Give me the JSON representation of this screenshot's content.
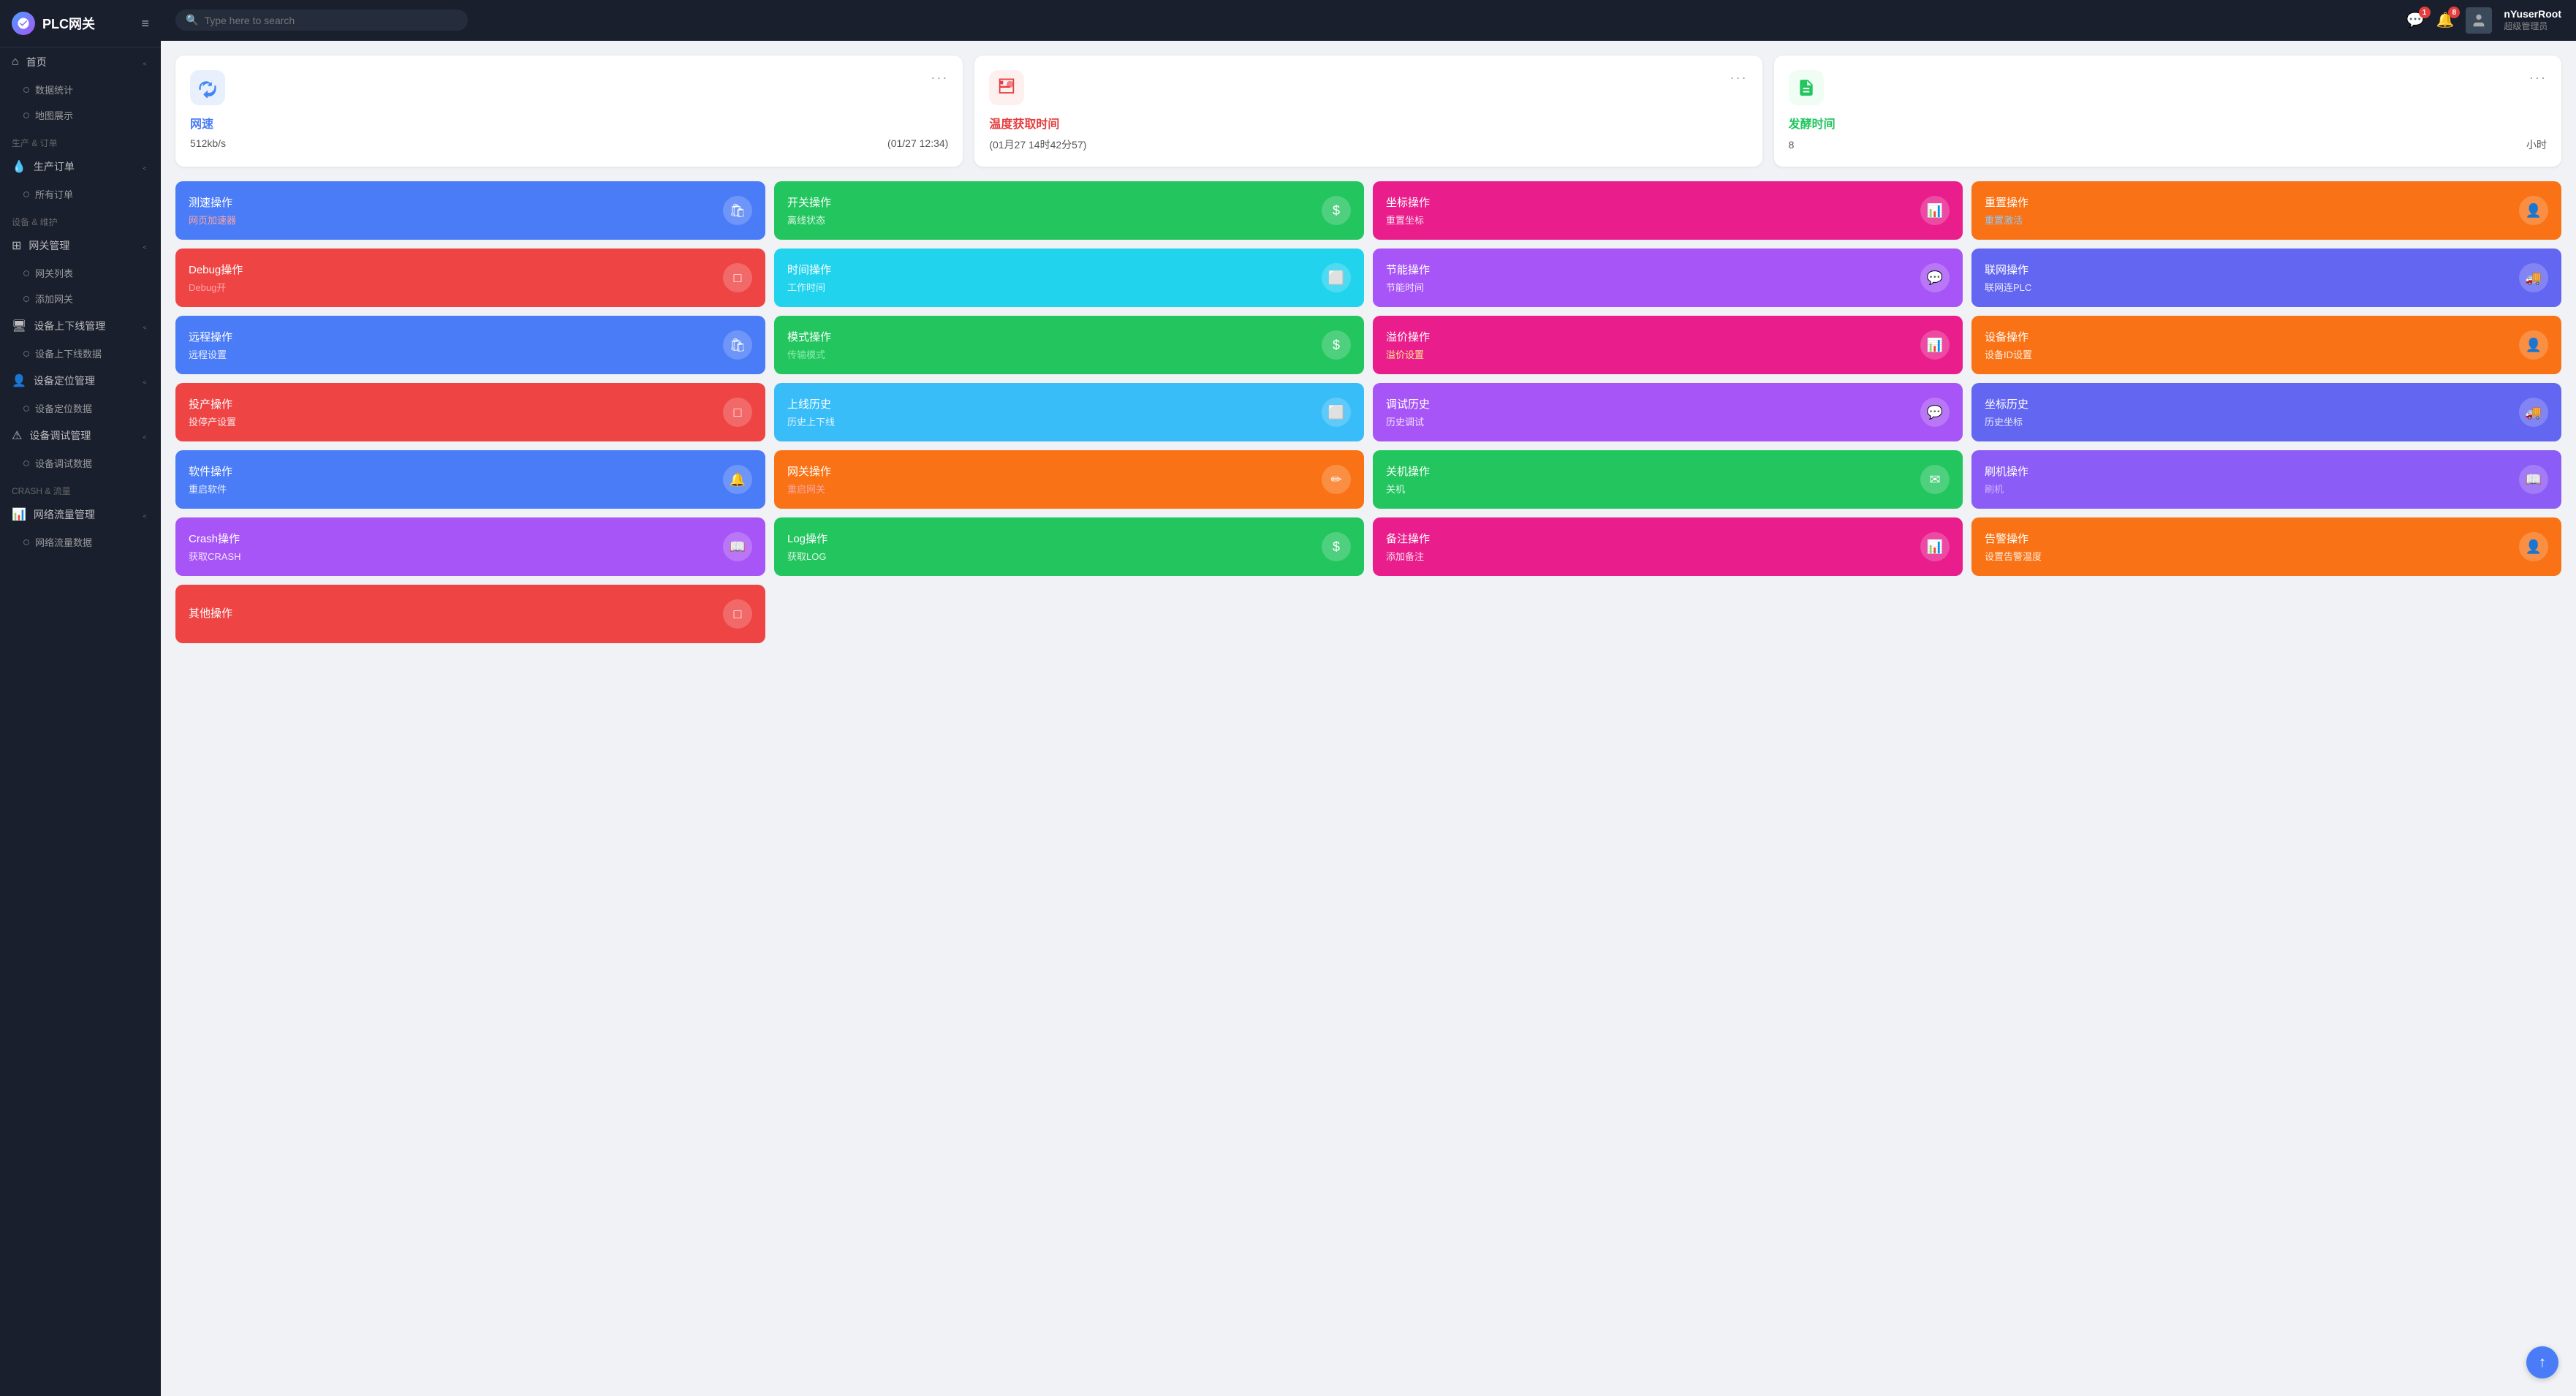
{
  "app": {
    "logo_icon": "⚙",
    "logo_text": "PLC网关",
    "hamburger": "≡"
  },
  "search": {
    "placeholder": "Type here to search"
  },
  "topbar": {
    "notif1_count": "1",
    "notif2_count": "8",
    "user_name": "nYuserRoot",
    "user_role": "超级管理员"
  },
  "sidebar": {
    "sections": [
      {
        "label": "",
        "items": [
          {
            "icon": "⌂",
            "label": "首页",
            "has_chevron": true,
            "sub": []
          },
          {
            "icon": "◉",
            "label": "数据统计",
            "has_chevron": false,
            "sub": []
          },
          {
            "icon": "◉",
            "label": "地图展示",
            "has_chevron": false,
            "sub": []
          }
        ]
      },
      {
        "label": "生产 & 订单",
        "items": [
          {
            "icon": "💧",
            "label": "生产订单",
            "has_chevron": true,
            "sub": []
          },
          {
            "icon": "◉",
            "label": "所有订单",
            "has_chevron": false,
            "sub": []
          }
        ]
      },
      {
        "label": "设备 & 维护",
        "items": [
          {
            "icon": "⊞",
            "label": "网关管理",
            "has_chevron": true,
            "sub": []
          },
          {
            "icon": "◉",
            "label": "网关列表",
            "has_chevron": false,
            "sub": []
          },
          {
            "icon": "◉",
            "label": "添加网关",
            "has_chevron": false,
            "sub": []
          },
          {
            "icon": "🖥",
            "label": "设备上下线管理",
            "has_chevron": true,
            "sub": []
          },
          {
            "icon": "◉",
            "label": "设备上下线数据",
            "has_chevron": false,
            "sub": []
          },
          {
            "icon": "👤",
            "label": "设备定位管理",
            "has_chevron": true,
            "sub": []
          },
          {
            "icon": "◉",
            "label": "设备定位数据",
            "has_chevron": false,
            "sub": []
          },
          {
            "icon": "⚠",
            "label": "设备调试管理",
            "has_chevron": true,
            "sub": []
          },
          {
            "icon": "◉",
            "label": "设备调试数据",
            "has_chevron": false,
            "sub": []
          }
        ]
      },
      {
        "label": "CRASH & 流量",
        "items": [
          {
            "icon": "📊",
            "label": "网络流量管理",
            "has_chevron": true,
            "sub": []
          },
          {
            "icon": "◉",
            "label": "网络流量数据",
            "has_chevron": false,
            "sub": []
          }
        ]
      }
    ]
  },
  "info_cards": [
    {
      "icon": "▲",
      "icon_color": "#4285f4",
      "icon_bg": "#e8f0fe",
      "title": "网速",
      "title_color": "#4a7cf7",
      "value": "512kb/s",
      "extra": "(01/27 12:34)"
    },
    {
      "icon": "📦",
      "icon_color": "#e53e3e",
      "icon_bg": "#fff0f0",
      "title": "温度获取时间",
      "title_color": "#e53e3e",
      "value": "(01月27 14时42分57)",
      "extra": ""
    },
    {
      "icon": "📗",
      "icon_color": "#22c55e",
      "icon_bg": "#f0fdf4",
      "title": "发酵时间",
      "title_color": "#22c55e",
      "value": "8",
      "extra": "小时"
    }
  ],
  "op_cards": [
    {
      "title": "测速操作",
      "sub": "网页加速器",
      "sub_class": "sub-red",
      "color_class": "bg-blue",
      "icon": "🛍"
    },
    {
      "title": "开关操作",
      "sub": "离线状态",
      "sub_class": "sub-white",
      "color_class": "bg-green",
      "icon": "$"
    },
    {
      "title": "坐标操作",
      "sub": "重置坐标",
      "sub_class": "sub-white",
      "color_class": "bg-pink",
      "icon": "📊"
    },
    {
      "title": "重置操作",
      "sub": "重置激活",
      "sub_class": "sub-blue",
      "color_class": "bg-orange",
      "icon": "👤"
    },
    {
      "title": "Debug操作",
      "sub": "Debug开",
      "sub_class": "sub-red",
      "color_class": "bg-red",
      "icon": "□"
    },
    {
      "title": "时间操作",
      "sub": "工作时间",
      "sub_class": "sub-white",
      "color_class": "bg-cyan",
      "icon": "⬜"
    },
    {
      "title": "节能操作",
      "sub": "节能时间",
      "sub_class": "sub-white",
      "color_class": "bg-purple",
      "icon": "💬"
    },
    {
      "title": "联网操作",
      "sub": "联网连PLC",
      "sub_class": "sub-white",
      "color_class": "bg-indigo",
      "icon": "🚚"
    },
    {
      "title": "远程操作",
      "sub": "远程设置",
      "sub_class": "sub-white",
      "color_class": "bg-blue",
      "icon": "🛍"
    },
    {
      "title": "模式操作",
      "sub": "传输模式",
      "sub_class": "sub-green",
      "color_class": "bg-green",
      "icon": "$"
    },
    {
      "title": "溢价操作",
      "sub": "溢价设置",
      "sub_class": "sub-yellow",
      "color_class": "bg-pink",
      "icon": "📊"
    },
    {
      "title": "设备操作",
      "sub": "设备ID设置",
      "sub_class": "sub-white",
      "color_class": "bg-orange",
      "icon": "👤"
    },
    {
      "title": "投产操作",
      "sub": "投停产设置",
      "sub_class": "sub-white",
      "color_class": "bg-red",
      "icon": "□"
    },
    {
      "title": "上线历史",
      "sub": "历史上下线",
      "sub_class": "sub-white",
      "color_class": "bg-light-blue",
      "icon": "⬜"
    },
    {
      "title": "调试历史",
      "sub": "历史调试",
      "sub_class": "sub-white",
      "color_class": "bg-purple",
      "icon": "💬"
    },
    {
      "title": "坐标历史",
      "sub": "历史坐标",
      "sub_class": "sub-white",
      "color_class": "bg-indigo",
      "icon": "🚚"
    },
    {
      "title": "软件操作",
      "sub": "重启软件",
      "sub_class": "sub-white",
      "color_class": "bg-blue",
      "icon": "🔔"
    },
    {
      "title": "网关操作",
      "sub": "重启网关",
      "sub_class": "sub-red",
      "color_class": "bg-orange",
      "icon": "✏"
    },
    {
      "title": "关机操作",
      "sub": "关机",
      "sub_class": "sub-white",
      "color_class": "bg-green",
      "icon": "✉"
    },
    {
      "title": "刷机操作",
      "sub": "刷机",
      "sub_class": "sub-purple",
      "color_class": "bg-violet",
      "icon": "📖"
    },
    {
      "title": "Crash操作",
      "sub": "获取CRASH",
      "sub_class": "sub-white",
      "color_class": "bg-purple",
      "icon": "📖"
    },
    {
      "title": "Log操作",
      "sub": "获取LOG",
      "sub_class": "sub-white",
      "color_class": "bg-green",
      "icon": "$"
    },
    {
      "title": "备注操作",
      "sub": "添加备注",
      "sub_class": "sub-white",
      "color_class": "bg-pink",
      "icon": "📊"
    },
    {
      "title": "告警操作",
      "sub": "设置告警温度",
      "sub_class": "sub-white",
      "color_class": "bg-orange",
      "icon": "👤"
    },
    {
      "title": "其他操作",
      "sub": "",
      "sub_class": "sub-white",
      "color_class": "bg-red",
      "icon": "□"
    }
  ],
  "scroll_top_btn": "↑"
}
